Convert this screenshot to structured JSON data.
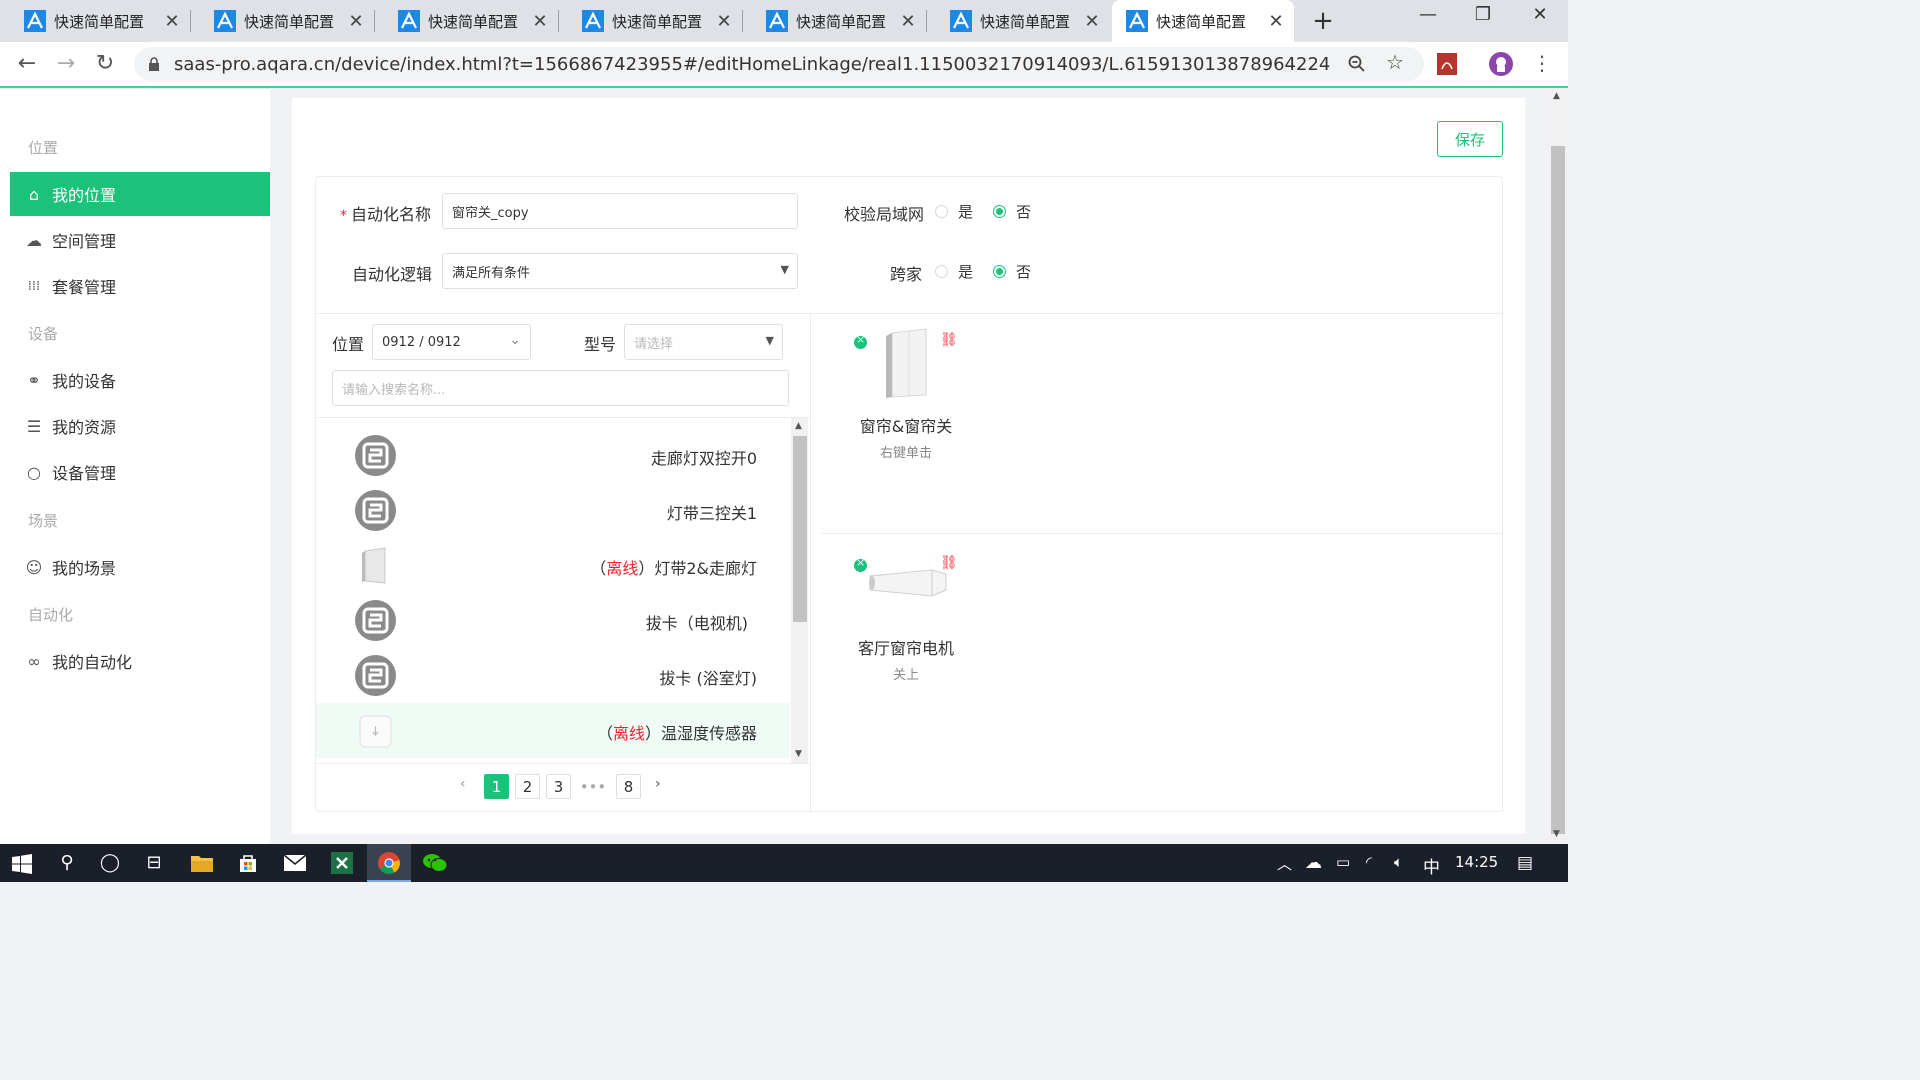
{
  "browser": {
    "tabs": [
      {
        "title": "快速简单配置",
        "active": false
      },
      {
        "title": "快速简单配置",
        "active": false
      },
      {
        "title": "快速简单配置",
        "active": false
      },
      {
        "title": "快速简单配置",
        "active": false
      },
      {
        "title": "快速简单配置",
        "active": false
      },
      {
        "title": "快速简单配置",
        "active": false
      },
      {
        "title": "快速简单配置",
        "active": true
      }
    ],
    "url": "saas-pro.aqara.cn/device/index.html?t=1566867423955#/editHomeLinkage/real1.1150032170914093/L.615913013878964224"
  },
  "sidebar": {
    "groups": [
      {
        "label": "位置",
        "items": [
          {
            "label": "我的位置",
            "icon": "home-icon",
            "active": true
          },
          {
            "label": "空间管理",
            "icon": "cloud-icon",
            "active": false
          },
          {
            "label": "套餐管理",
            "icon": "grid-icon",
            "active": false
          }
        ]
      },
      {
        "label": "设备",
        "items": [
          {
            "label": "我的设备",
            "icon": "devices-icon",
            "active": false
          },
          {
            "label": "我的资源",
            "icon": "sliders-icon",
            "active": false
          },
          {
            "label": "设备管理",
            "icon": "circle-icon",
            "active": false
          }
        ]
      },
      {
        "label": "场景",
        "items": [
          {
            "label": "我的场景",
            "icon": "smile-icon",
            "active": false
          }
        ]
      },
      {
        "label": "自动化",
        "items": [
          {
            "label": "我的自动化",
            "icon": "infinity-icon",
            "active": false
          }
        ]
      }
    ]
  },
  "toolbar": {
    "save_label": "保存"
  },
  "form": {
    "name_label": "自动化名称",
    "name_value": "窗帘关_copy",
    "logic_label": "自动化逻辑",
    "logic_value": "满足所有条件",
    "lan_label": "校验局域网",
    "cross_label": "跨家",
    "yes": "是",
    "no": "否",
    "lan_selected": "否",
    "cross_selected": "否"
  },
  "device_picker": {
    "location_label": "位置",
    "location_value": "0912 / 0912",
    "model_label": "型号",
    "model_placeholder": "请选择",
    "search_placeholder": "请输入搜索名称...",
    "offline_label": "离线",
    "devices": [
      {
        "name": "走廊灯双控开0",
        "offline": false,
        "icon": "hub-icon"
      },
      {
        "name": "灯带三控关1",
        "offline": false,
        "icon": "hub-icon"
      },
      {
        "name": "）灯带2&走廊灯",
        "offline": true,
        "icon": "wall-switch-icon"
      },
      {
        "name": "拔卡（电视机)",
        "offline": false,
        "icon": "hub-icon"
      },
      {
        "name": "拔卡 (浴室灯)",
        "offline": false,
        "icon": "hub-icon"
      },
      {
        "name": "）温湿度传感器",
        "offline": true,
        "icon": "sensor-icon"
      }
    ],
    "pagination": {
      "pages": [
        "1",
        "2",
        "3",
        "•••",
        "8"
      ],
      "current": "1"
    }
  },
  "actions": [
    {
      "name": "窗帘&窗帘关",
      "action": "右键单击",
      "icon": "wall-switch-icon"
    },
    {
      "name": "客厅窗帘电机",
      "action": "关上",
      "icon": "curtain-motor-icon"
    }
  ],
  "taskbar": {
    "ime": "中",
    "time": "14:25"
  },
  "colors": {
    "accent": "#1cc27a",
    "danger": "#f5222d"
  }
}
